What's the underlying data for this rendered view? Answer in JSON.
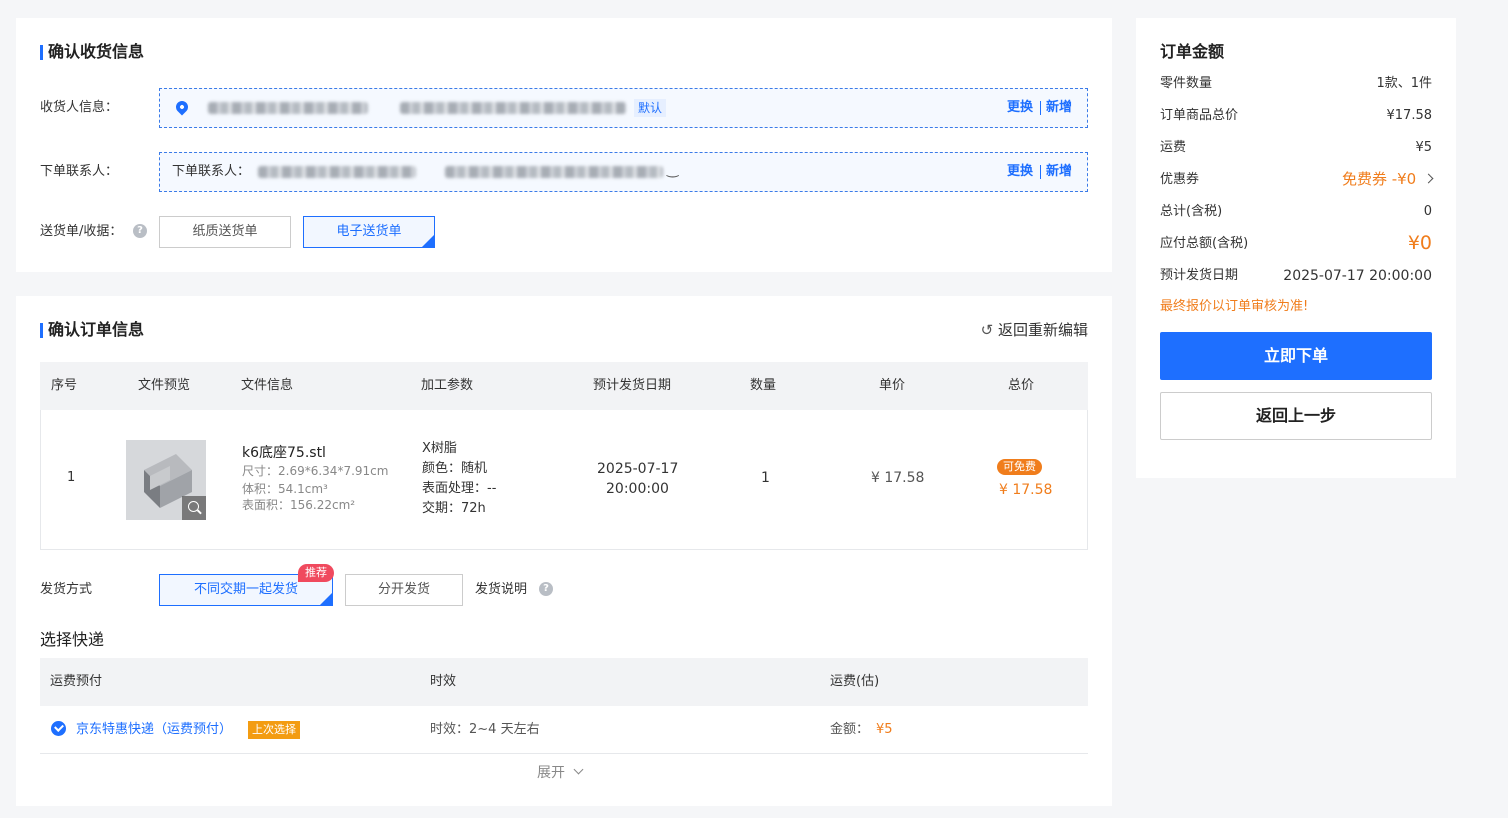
{
  "receipt": {
    "title": "确认收货信息",
    "receiver_label": "收货人信息：",
    "default_tag": "默认",
    "contact_label": "下单联系人：",
    "contact_prefix": "下单联系人：",
    "change": "更换",
    "add": "新增",
    "delivery_note_label": "送货单/收据：",
    "paper_option": "纸质送货单",
    "electronic_option": "电子送货单"
  },
  "order": {
    "title": "确认订单信息",
    "back_edit": "返回重新编辑",
    "columns": [
      "序号",
      "文件预览",
      "文件信息",
      "加工参数",
      "预计发货日期",
      "数量",
      "单价",
      "总价"
    ],
    "item": {
      "index": "1",
      "file_name": "k6底座75.stl",
      "size": "尺寸：2.69*6.34*7.91cm",
      "volume": "体积：54.1cm³",
      "surface": "表面积：156.22cm²",
      "material": "X树脂",
      "color": "颜色：随机",
      "surface_treatment": "表面处理：--",
      "lead_time": "交期：72h",
      "ship_date": "2025-07-17",
      "ship_time": "20:00:00",
      "quantity": "1",
      "unit_price": "¥ 17.58",
      "free_badge": "可免费",
      "total_price": "¥ 17.58"
    },
    "shipping_method_label": "发货方式",
    "ship_together": "不同交期一起发货",
    "recommend_badge": "推荐",
    "ship_separately": "分开发货",
    "shipping_note": "发货说明"
  },
  "express": {
    "title": "选择快递",
    "columns": [
      "运费预付",
      "时效",
      "运费(估)"
    ],
    "option": {
      "name": "京东特惠快递（运费预付）",
      "last_tag": "上次选择",
      "time": "时效：2~4 天左右",
      "amount_label": "金额：",
      "amount": "¥5"
    },
    "expand": "展开"
  },
  "summary": {
    "title": "订单金额",
    "rows": [
      {
        "label": "零件数量",
        "value": "1款、1件"
      },
      {
        "label": "订单商品总价",
        "value": "¥17.58"
      },
      {
        "label": "运费",
        "value": "¥5"
      },
      {
        "label": "优惠券",
        "value": "免费券 -¥0"
      },
      {
        "label": "总计(含税)",
        "value": "0"
      },
      {
        "label": "应付总额(含税)",
        "value": "¥0"
      },
      {
        "label": "预计发货日期",
        "value": "2025-07-17 20:00:00"
      }
    ],
    "notice": "最终报价以订单审核为准!",
    "submit": "立即下单",
    "back": "返回上一步"
  },
  "colors": {
    "accent": "#1e6fff",
    "orange": "#f07d1c",
    "badge_red": "#f04a5e"
  }
}
